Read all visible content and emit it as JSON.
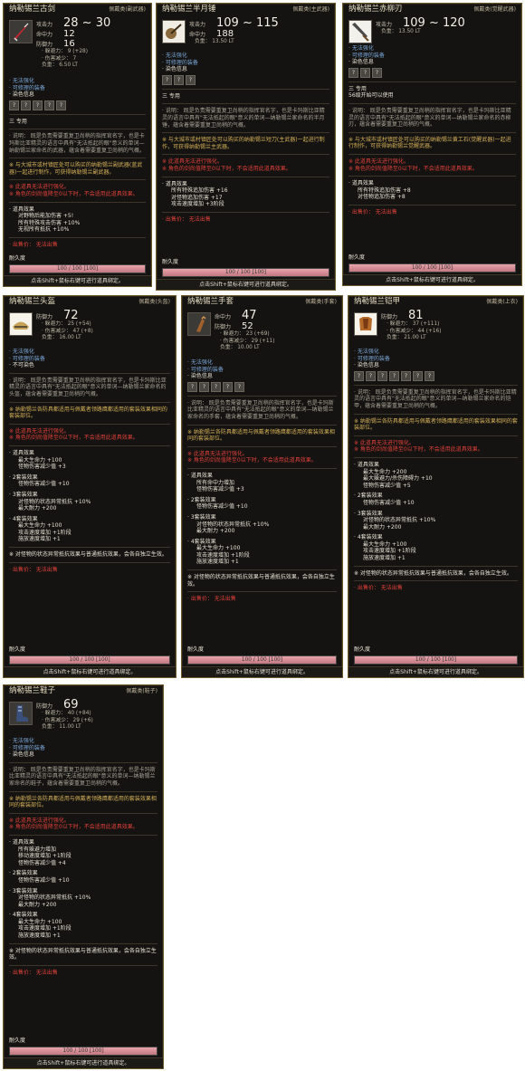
{
  "cards": [
    {
      "id": "c1",
      "name": "纳勒锡兰古剑",
      "category": "佩戴类(副武器)",
      "icon": "dagger-icon",
      "stats": [
        [
          "攻击力",
          "28 ~ 30"
        ],
        [
          "命中力",
          "12"
        ],
        [
          "防御力",
          "16"
        ]
      ],
      "substats": [
        "· 躲避力：  9 (+28)",
        "· 伤害减少：  7",
        "负重：  6.50 LT"
      ],
      "props": [
        "· 无法强化",
        "· 可修理的装备",
        "· 染色信息"
      ],
      "sockets": 5,
      "role": "三 专用",
      "desc": "· 说明：  既是负责需要重复卫尚稍的指挥官名字，也是卡玛斯比亚精灵的语言中具有\"无法抵起的眼\"意义的单词—纳勒锡兰家命名的武器，蕴含着需要重复卫尚稍的气概。",
      "note1": "※ 与大城市或村镇匠处可以购买的纳勒锡兰副武器(蓝武器)一起进行制作，可获得纳勒锡兰副武器。",
      "note2": [
        "※ 此道具无法进行强化。",
        "※ 角色的剑尚值降至0以下时，不会适用此道具效果。"
      ],
      "effects_title": "· 道具效果",
      "effects": [
        "对野物后能加伤害 +5!",
        "所有特殊攻击伤害 +10%",
        "无视所有抵抗 +10%"
      ],
      "price": "· 出售价：  无法出售",
      "durability_label": "耐久度",
      "durability": "100 / 100 [100]",
      "footer": "点击Shift+鼠标右键可进行道具绑定。"
    },
    {
      "id": "c2",
      "name": "纳勒锡兰半月锤",
      "category": "佩戴类(主武器)",
      "icon": "mace-icon",
      "stats": [
        [
          "攻击力",
          "109 ~ 115"
        ],
        [
          "命中力",
          "188"
        ]
      ],
      "substats": [
        "负重：  13.50 LT"
      ],
      "props": [
        "· 无法强化",
        "· 可修理的装备",
        "· 染色信息"
      ],
      "sockets": 3,
      "role": "三 专用",
      "desc": "· 说明：  既是负责需要重复卫尚稍的指挥官名字，也是卡玛斯比亚精灵的语言中具有\"无法抵起的眼\"意义的单词—纳勒锡兰家命名的半月锤，蕴含着需要重复卫尚稍的气概。",
      "note1": "※ 与大城市或村镇匠处可以购买的纳勒锡兰短刀(主武器)一起进行制作，可获得纳勒锡兰主武器。",
      "note2": [
        "※ 此道具无法进行强化。",
        "※ 角色的剑尚值降至0以下时，不会适用此道具效果。"
      ],
      "effects_title": "· 道具效果",
      "effects": [
        "所有特殊追加伤害 +16",
        "对怪物追加伤害 +17",
        "攻击速度增加 +3阶段"
      ],
      "price": "· 出售价：  无法出售",
      "durability_label": "耐久度",
      "durability": "100 / 100 [100]",
      "footer": "点击Shift+鼠标右键可进行道具绑定。"
    },
    {
      "id": "c3",
      "name": "纳勒锡兰赤柳刃",
      "category": "佩戴类(觉醒武器)",
      "icon": "blade-icon",
      "stats": [
        [
          "攻击力",
          "109 ~ 120"
        ]
      ],
      "substats": [
        "负重：  13.50 LT"
      ],
      "props": [
        "· 无法强化",
        "· 可修理的装备",
        "· 染色信息"
      ],
      "sockets": 3,
      "role": "三 专用",
      "extra": "56级开始可以使用",
      "desc": "· 说明：  既是负责需要重复卫尚稍的指挥官名字，也是卡玛斯比亚精灵的语言中具有\"无法抵起的眼\"意义的单词—纳勒锡兰家命名的赤柳刃，蕴含着需要重复卫尚稍的气概。",
      "note1": "※ 与大城市或村镇匠处可以购买的纳勒锡兰黄工石(觉醒武器)一起进行制作，可获得纳勒锡兰觉醒武器。",
      "note2": [
        "※ 此道具无法进行强化。",
        "※ 角色的剑尚值降至0以下时，不会适用此道具效果。"
      ],
      "effects_title": "· 道具效果",
      "effects": [
        "所有特殊追加伤害 +8",
        "对怪物追加伤害 +8"
      ],
      "price": "· 出售价：  无法出售",
      "durability_label": "耐久度",
      "durability": "100 / 100 [100]",
      "footer": "点击Shift+鼠标右键可进行道具绑定。"
    },
    {
      "id": "c4",
      "name": "纳勒锡兰头盔",
      "category": "佩戴类(头盔)",
      "icon": "helmet-icon",
      "stats": [
        [
          "防御力",
          "72"
        ]
      ],
      "substats": [
        "· 躲避力：  25 (+54)",
        "· 伤害减少：  47 (+8)",
        "负重：  16.00 LT"
      ],
      "props": [
        "· 无法强化",
        "· 可修理的装备",
        "· 不可染色"
      ],
      "sockets": 0,
      "desc": "· 说明：  既是负责需要重复卫尚稍的指挥官名字，也是卡玛斯比亚精灵的语言中具有\"无法抵起的眼\"意义的单词—纳勒锡兰家命名的头盔，蕴含着需要重复卫尚稍的气概。",
      "note1": "※ 纳勒锡兰各防具都适用与佩戴者领路鹰都适用的套装效果相同的套装部位。",
      "note2": [
        "※ 此道具无法进行强化。",
        "※ 角色的剑尚值降至0以下时，不会适用此道具效果。"
      ],
      "effects_title": "· 道具效果",
      "effects": [
        "最大生命力 +100",
        "怪物伤害减少值 +3"
      ],
      "sets": [
        {
          "t": "· 2套装效果",
          "l": [
            "怪物伤害减少值 +10"
          ]
        },
        {
          "t": "· 3套装效果",
          "l": [
            "对怪物的状态异常抵抗 +10%",
            "最大耐力 +200"
          ]
        },
        {
          "t": "· 4套装效果",
          "l": [
            "最大生命力 +100",
            "攻击速度增加 +1阶段",
            "施放速度增加 +1"
          ]
        }
      ],
      "setnote": "※ 对怪物的状态异常抵抗效果与普通抵抗效果，会各自独立生效。",
      "price": "· 出售价：  无法出售",
      "durability_label": "耐久度",
      "durability": "100 / 100 [100]",
      "footer": "点击Shift+鼠标右键可进行道具绑定。"
    },
    {
      "id": "c5",
      "name": "纳勒锡兰手套",
      "category": "佩戴类(手套)",
      "icon": "glove-icon",
      "stats": [
        [
          "命中力",
          "47"
        ],
        [
          "防御力",
          "52"
        ]
      ],
      "substats": [
        "· 躲避力：  23 (+69)",
        "· 伤害减少：  29 (+11)",
        "负重：  10.00 LT"
      ],
      "props": [
        "· 无法强化",
        "· 可修理的装备",
        "· 染色信息"
      ],
      "sockets": 5,
      "desc": "· 说明：  既是负责需要重复卫尚稍的指挥官名字，也是卡玛斯比亚精灵的语言中具有\"无法抵起的眼\"意义的单词—纳勒锡兰家命名的手套，蕴含着需要重复卫尚稍的气概。",
      "note1": "※ 纳勒锡兰各防具都适用与佩戴者领路鹰都适用的套装效果相同的套装部位。",
      "note2": [
        "※ 此道具无法进行强化。",
        "※ 角色的剑尚值降至0以下时，不会适用此道具效果。"
      ],
      "effects_title": "· 道具效果",
      "effects": [
        "所有命中力增加",
        "怪物伤害减少值 +3"
      ],
      "sets": [
        {
          "t": "· 2套装效果",
          "l": [
            "怪物伤害减少值 +10"
          ]
        },
        {
          "t": "· 3套装效果",
          "l": [
            "对怪物的状态异常抵抗 +10%",
            "最大耐力 +200"
          ]
        },
        {
          "t": "· 4套装效果",
          "l": [
            "最大生命力 +100",
            "攻击速度增加 +1阶段",
            "施放速度增加 +1"
          ]
        }
      ],
      "setnote": "※ 对怪物的状态异常抵抗效果与普通抵抗效果，会各自独立生效。",
      "price": "· 出售价：  无法出售",
      "durability_label": "耐久度",
      "durability": "100 / 100 [100]",
      "footer": "点击Shift+鼠标右键可进行道具绑定。"
    },
    {
      "id": "c6",
      "name": "纳勒锡兰铠甲",
      "category": "佩戴类(上衣)",
      "icon": "armor-icon",
      "stats": [
        [
          "防御力",
          "81"
        ]
      ],
      "substats": [
        "· 躲避力：  37 (+111)",
        "· 伤害减少：  44 (+16)",
        "负重：  21.00 LT"
      ],
      "props": [
        "· 无法强化",
        "· 可修理的装备",
        "· 染色信息"
      ],
      "sockets": 7,
      "desc": "· 说明：  既是负责需要重复卫尚稍的指挥官名字，也是卡玛斯比亚精灵的语言中具有\"无法抵起的眼\"意义的单词—纳勒锡兰家命名的铠甲，蕴含着需要重复卫尚稍的气概。",
      "note1": "※ 纳勒锡兰各防具都适用与佩戴者领路鹰都适用的套装效果相同的套装部位。",
      "note2": [
        "※ 此道具无法进行强化。",
        "※ 角色的剑尚值降至0以下时，不会适用此道具效果。"
      ],
      "effects_title": "· 道具效果",
      "effects": [
        "最大生命力 +200",
        "最大躲避力/杀伤障碍力 +10",
        "怪物伤害减少值 +5"
      ],
      "sets": [
        {
          "t": "· 2套装效果",
          "l": [
            "怪物伤害减少值 +10"
          ]
        },
        {
          "t": "· 3套装效果",
          "l": [
            "对怪物的状态异常抵抗 +10%",
            "最大耐力 +200"
          ]
        },
        {
          "t": "· 4套装效果",
          "l": [
            "最大生命力 +100",
            "攻击速度增加 +1阶段",
            "施放速度增加 +1"
          ]
        }
      ],
      "setnote": "※ 对怪物的状态异常抵抗效果与普通抵抗效果，会各自独立生效。",
      "price": "· 出售价：  无法出售",
      "durability_label": "耐久度",
      "durability": "100 / 100 [100]",
      "footer": "点击Shift+鼠标右键可进行道具绑定。"
    },
    {
      "id": "c7",
      "name": "纳勒锡兰鞋子",
      "category": "佩戴类(鞋子)",
      "icon": "boot-icon",
      "stats": [
        [
          "防御力",
          "69"
        ]
      ],
      "substats": [
        "· 躲避力：  40 (+84)",
        "· 伤害减少：  29 (+6)",
        "负重：  11.00 LT"
      ],
      "props": [
        "· 无法强化",
        "· 可修理的装备",
        "· 染色信息"
      ],
      "sockets": 0,
      "desc": "· 说明：  既是负责需要重复卫尚稍的指挥官名字，也是卡玛斯比亚精灵的语言中具有\"无法抵起的眼\"意义的单词—纳勒锡兰家命名的鞋子，蕴含着需要重复卫尚稍的气概。",
      "note1": "※ 纳勒锡兰各防具都适用与佩戴者领路鹰都适用的套装效果相同的套装部位。",
      "note2": [
        "※ 此道具无法进行强化。",
        "※ 角色的剑尚值降至0以下时，不会适用此道具效果。"
      ],
      "effects_title": "· 道具效果",
      "effects": [
        "所有躲避力增加",
        "移动速度增加 +1阶段",
        "怪物伤害减少值 +4"
      ],
      "sets": [
        {
          "t": "· 2套装效果",
          "l": [
            "怪物伤害减少值 +10"
          ]
        },
        {
          "t": "· 3套装效果",
          "l": [
            "对怪物的状态异常抵抗 +10%",
            "最大耐力 +200"
          ]
        },
        {
          "t": "· 4套装效果",
          "l": [
            "最大生命力 +100",
            "攻击速度增加 +1阶段",
            "施放速度增加 +1"
          ]
        }
      ],
      "setnote": "※ 对怪物的状态异常抵抗效果与普通抵抗效果，会各自独立生效。",
      "price": "· 出售价：  无法出售",
      "durability_label": "耐久度",
      "durability": "100 / 100 [100]",
      "footer": "点击Shift+鼠标右键可进行道具绑定。"
    }
  ]
}
